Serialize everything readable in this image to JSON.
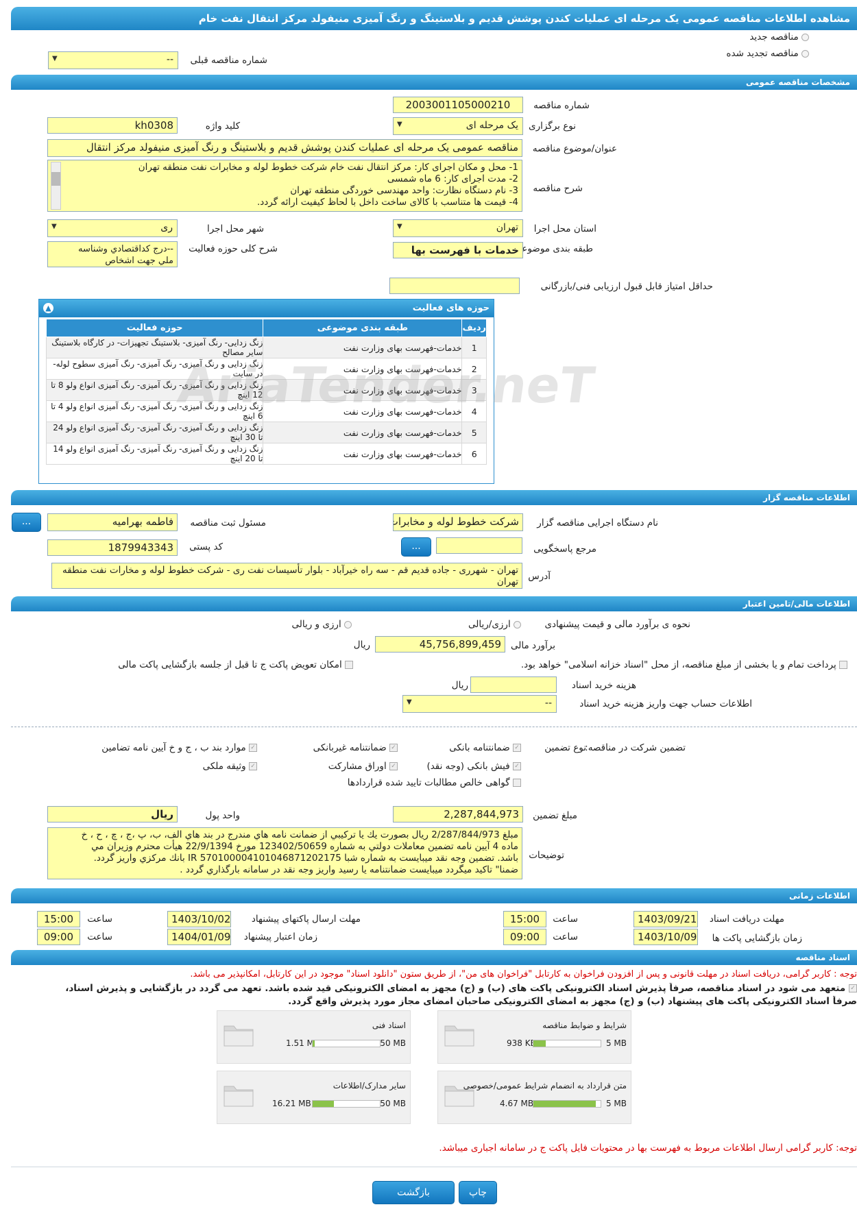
{
  "title": "مشاهده اطلاعات مناقصه عمومی یک مرحله ای عملیات کندن پوشش قدیم و بلاستینگ و رنگ آمیزی منیفولد مرکز انتقال نفت خام",
  "top": {
    "new_label": "مناقصه جدید",
    "renewed_label": "مناقصه تجدید شده",
    "prev_label": "شماره مناقصه قبلی",
    "prev_value": "--"
  },
  "general": {
    "header": "مشخصات مناقصه عمومی",
    "number_label": "شماره مناقصه",
    "number": "2003001105000210",
    "type_label": "نوع برگزاری",
    "type": "یک مرحله ای",
    "keyword_label": "کلید واژه",
    "keyword": "kh0308",
    "subject_label": "عنوان/موضوع مناقصه",
    "subject": "مناقصه عمومی یک مرحله ای عملیات کندن پوشش قدیم و بلاستینگ و رنگ آمیزی منیفولد مرکز انتقال",
    "desc_label": "شرح مناقصه",
    "desc_lines": [
      "1-    محل و مکان اجرای کار: مرکز انتقال نفت خام شرکت خطوط لوله و مخابرات نفت منطقه تهران",
      "2-    مدت اجرای کار: 6 ماه شمسی",
      "3-    نام دستگاه نظارت: واحد مهندسی خوردگی منطقه تهران",
      "4-    قیمت ها متناسب با کالای ساخت داخل با لحاظ کیفیت ارائه گردد."
    ],
    "province_label": "استان محل اجرا",
    "province": "تهران",
    "city_label": "شهر محل اجرا",
    "city": "ری",
    "category_label": "طبقه بندی موضوعی",
    "category": "خدمات با فهرست بها",
    "activity_label": "شرح کلی حوزه فعالیت",
    "activity_lines": [
      "--درج کداقتصادي وشناسه",
      "ملي جهت اشخاص"
    ],
    "minscore_label": "حداقل امتیاز قابل قبول ارزیابی فنی/بازرگانی",
    "minscore": ""
  },
  "activities": {
    "title": "حوزه های فعالیت",
    "headers": [
      "ردیف",
      "طبقه بندی موضوعی",
      "حوزه فعالیت"
    ],
    "rows": [
      {
        "n": "1",
        "cat": "خدمات-فهرست بهای وزارت نفت",
        "act": "زنگ زدایی- رنگ آمیزی- بلاستینگ تجهیزات- در کارگاه بلاستینگ سایر مصالح"
      },
      {
        "n": "2",
        "cat": "خدمات-فهرست بهای وزارت نفت",
        "act": "زنگ زدایی و رنگ آمیزی- رنگ آمیزی- رنگ آمیزی سطوح لوله- در سایت"
      },
      {
        "n": "3",
        "cat": "خدمات-فهرست بهای وزارت نفت",
        "act": "زنگ زدایی و رنگ آمیزی- رنگ آمیزی-  رنگ آمیزی انواع ولو 8 تا 12 اینچ"
      },
      {
        "n": "4",
        "cat": "خدمات-فهرست بهای وزارت نفت",
        "act": "زنگ زدایی و رنگ آمیزی- رنگ آمیزی- رنگ آمیزی انواع ولو 4 تا 6 اینچ"
      },
      {
        "n": "5",
        "cat": "خدمات-فهرست بهای وزارت نفت",
        "act": "زنگ زدایی و رنگ آمیزی- رنگ آمیزی- رنگ آمیزی انواع ولو 24 تا 30 اینچ"
      },
      {
        "n": "6",
        "cat": "خدمات-فهرست بهای وزارت نفت",
        "act": "زنگ زدایی و رنگ آمیزی- رنگ آمیزی- رنگ آمیزی انواع ولو 14 تا 20 اینچ"
      }
    ]
  },
  "watermark": "AriaTender.neT",
  "org": {
    "header": "اطلاعات مناقصه گزار",
    "exec_label": "نام دستگاه اجرایی مناقصه گزار",
    "exec": "شرکت خطوط لوله و مخابرات",
    "resp_label": "مسئول ثبت مناقصه",
    "resp": "فاطمه بهرامیه",
    "ref_label": "مرجع پاسخگویی",
    "ref": "",
    "postal_label": "کد پستی",
    "postal": "1879943343",
    "address_label": "آدرس",
    "address": "تهران - شهرری - جاده قدیم قم - سه راه خیرآباد - بلوار تأسیسات نفت ری - شرکت خطوط لوله و مخارات نفت منطقه تهران",
    "dots": "..."
  },
  "finance": {
    "header": "اطلاعات مالی/تامین اعتبار",
    "method_label": "نحوه ی برآورد مالی و قیمت پیشنهادی",
    "opt1": "ارزی/ریالی",
    "opt2": "ارزی و ریالی",
    "estimate_label": "برآورد مالی",
    "estimate": "45,756,899,459",
    "rial": "ریال",
    "treasury": "پرداخت تمام و یا بخشی از مبلغ مناقصه، از محل \"اسناد خزانه اسلامی\" خواهد بود.",
    "swap": "امکان تعویض پاکت ج تا قبل از جلسه بازگشایی پاکت مالی",
    "doccost_label": "هزینه خرید اسناد",
    "doccost": "",
    "account_label": "اطلاعات حساب جهت واریز هزینه خرید اسناد",
    "account": "--"
  },
  "guarantee": {
    "label": "تضمین شرکت در مناقصه:",
    "type_label": "نوع تضمین",
    "items": [
      "ضمانتنامه بانکی",
      "ضمانتنامه غیربانکی",
      "موارد بند ب ، ج و خ آیین نامه تضامین",
      "فیش بانکی (وجه نقد)",
      "اوراق مشارکت",
      "وثیقه ملکی",
      "گواهی خالص مطالبات تایید شده قراردادها"
    ],
    "amount_label": "مبلغ تضمین",
    "amount": "2,287,844,973",
    "unit_label": "واحد پول",
    "unit": "ریال",
    "notes_label": "توضیحات",
    "notes_lines": [
      "مبلغ 2/287/844/973 ريال بصورت يك يا تركيبي از ضمانت نامه هاي مندرج در بند هاي الف، ب، پ ،ج ، چ ، ح ، خ",
      "ماده 4 آيين نامه تضمين معاملات دولتي به شماره 123402/50659 مورخ 22/9/1394 هيأت محترم وزيران مي",
      "باشد. تضمين وجه نقد ميبايست به شماره شبا IR 570100004101046871202175  بانك مركزي واريز گردد.",
      "ضمنا\" تاكيد ميگردد ميبايست ضمانتنامه يا رسيد واريز وجه نقد در سامانه بارگذاري گردد ."
    ]
  },
  "times": {
    "header": "اطلاعات زمانی",
    "doc_label": "مهلت دریافت اسناد",
    "doc_date": "1403/09/21",
    "doc_time": "15:00",
    "send_label": "مهلت ارسال پاکتهای پیشنهاد",
    "send_date": "1403/10/02",
    "send_time": "15:00",
    "open_label": "زمان بازگشایی پاکت ها",
    "open_date": "1403/10/09",
    "open_time": "09:00",
    "valid_label": "زمان اعتبار پیشنهاد",
    "valid_date": "1404/01/09",
    "valid_time": "09:00",
    "time_label": "ساعت"
  },
  "docs": {
    "header": "اسناد مناقصه",
    "note1": "توجه : کاربر گرامی، دریافت اسناد در مهلت قانونی و پس از افزودن فراخوان به کارتابل \"فراخوان های من\"، از طریق ستون \"دانلود اسناد\" موجود در این کارتابل، امکانپذیر می باشد.",
    "commit1": "متعهد می شود در اسناد مناقصه، صرفاً پذیرش اسناد الکترونیکی پاکت های (ب) و (ج) مجهز به امضای الکترونیکی قید شده باشد. تعهد می گردد در بازگشایی و پذیرش اسناد،",
    "commit2": "صرفاً اسناد الکترونیکی پاکت های پیشنهاد (ب) و (ج) مجهز به امضای الکترونیکی صاحبان امضای مجاز مورد پذیرش واقع گردد.",
    "cards": [
      {
        "name": "شرایط و ضوابط مناقصه",
        "size": "938 KB",
        "max": "5 MB",
        "fill": 0.18
      },
      {
        "name": "اسناد فنی",
        "size": "1.51 MB",
        "max": "50 MB",
        "fill": 0.03
      },
      {
        "name": "متن قرارداد به انضمام شرایط عمومی/خصوصی",
        "size": "4.67 MB",
        "max": "5 MB",
        "fill": 0.93
      },
      {
        "name": "سایر مدارک/اطلاعات",
        "size": "16.21 MB",
        "max": "50 MB",
        "fill": 0.32
      }
    ],
    "note2": "توجه: کاربر گرامی ارسال اطلاعات مربوط به فهرست بها در محتویات فایل پاکت ج در سامانه اجباری میباشد."
  },
  "buttons": {
    "back": "بازگشت",
    "print": "چاپ"
  },
  "colors": {
    "accent": "#1f86c6",
    "field": "#ffffa8",
    "note": "#d60000"
  }
}
